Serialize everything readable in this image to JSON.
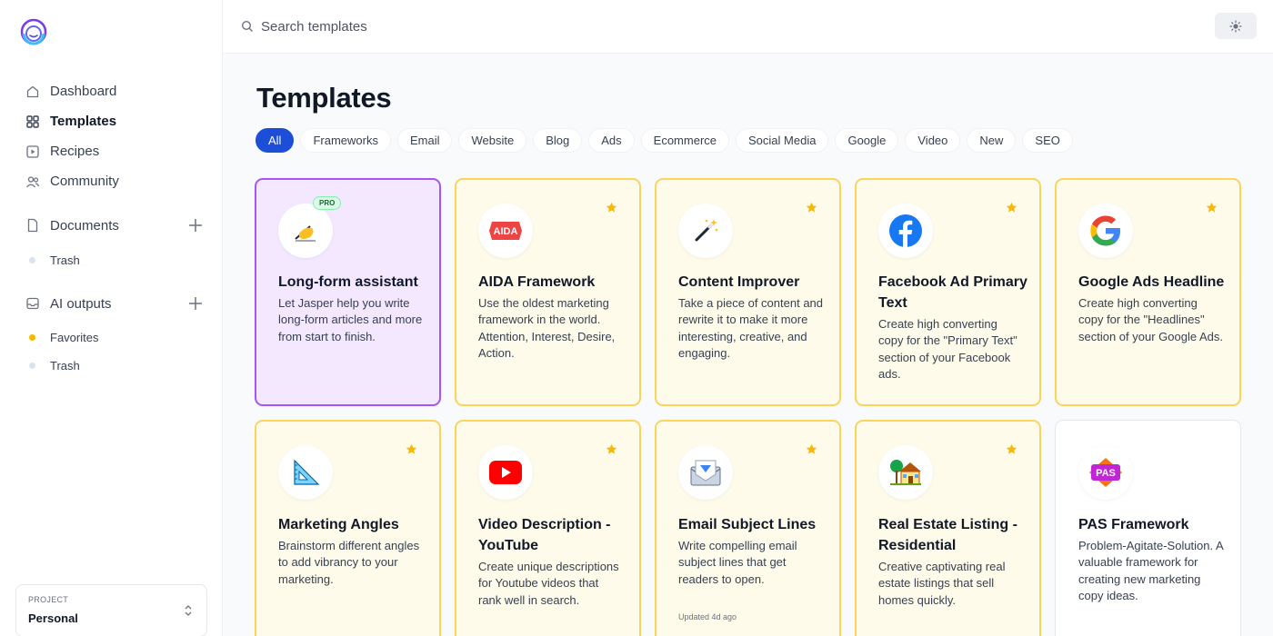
{
  "search": {
    "placeholder": "Search templates"
  },
  "sidebar": {
    "nav": [
      {
        "label": "Dashboard",
        "icon": "home-icon"
      },
      {
        "label": "Templates",
        "icon": "grid-icon",
        "active": true
      },
      {
        "label": "Recipes",
        "icon": "play-square-icon"
      },
      {
        "label": "Community",
        "icon": "users-icon"
      }
    ],
    "documents": {
      "label": "Documents",
      "trash": "Trash"
    },
    "ai_outputs": {
      "label": "AI outputs",
      "favorites": "Favorites",
      "trash": "Trash"
    },
    "project": {
      "label": "PROJECT",
      "value": "Personal"
    }
  },
  "main": {
    "title": "Templates",
    "filters": [
      "All",
      "Frameworks",
      "Email",
      "Website",
      "Blog",
      "Ads",
      "Ecommerce",
      "Social Media",
      "Google",
      "Video",
      "New",
      "SEO"
    ],
    "active_filter": "All",
    "cards": [
      {
        "title": "Long-form assistant",
        "description": "Let Jasper help you write long-form articles and more from start to finish.",
        "icon": "writing-hand-icon",
        "badge": "PRO",
        "style": "pro"
      },
      {
        "title": "AIDA Framework",
        "description": "Use the oldest marketing framework in the world. Attention, Interest, Desire, Action.",
        "icon": "aida-icon",
        "icon_text": "AIDA",
        "starred": true
      },
      {
        "title": "Content Improver",
        "description": "Take a piece of content and rewrite it to make it more interesting, creative, and engaging.",
        "icon": "magic-wand-icon",
        "starred": true
      },
      {
        "title": "Facebook Ad Primary Text",
        "description": "Create high converting copy for the \"Primary Text\" section of your Facebook ads.",
        "icon": "facebook-icon",
        "starred": true
      },
      {
        "title": "Google Ads Headline",
        "description": "Create high converting copy for the \"Headlines\" section of your Google Ads.",
        "icon": "google-icon",
        "starred": true
      },
      {
        "title": "Marketing Angles",
        "description": "Brainstorm different angles to add vibrancy to your marketing.",
        "icon": "triangle-ruler-icon",
        "starred": true
      },
      {
        "title": "Video Description - YouTube",
        "description": "Create unique descriptions for Youtube videos that rank well in search.",
        "icon": "youtube-icon",
        "starred": true
      },
      {
        "title": "Email Subject Lines",
        "description": "Write compelling email subject lines that get readers to open.",
        "icon": "envelope-icon",
        "starred": true,
        "meta": "Updated 4d ago"
      },
      {
        "title": "Real Estate Listing - Residential",
        "description": "Creative captivating real estate listings that sell homes quickly.",
        "icon": "house-icon",
        "starred": true
      },
      {
        "title": "PAS Framework",
        "description": "Problem-Agitate-Solution. A valuable framework for creating new marketing copy ideas.",
        "icon": "pas-icon",
        "icon_text": "PAS",
        "style": "plain"
      }
    ]
  },
  "colors": {
    "accent": "#1d4ed8",
    "card_border": "#fad45b",
    "card_bg": "#fffbeb",
    "pro_border": "#a855f7",
    "star": "#f6b800"
  }
}
